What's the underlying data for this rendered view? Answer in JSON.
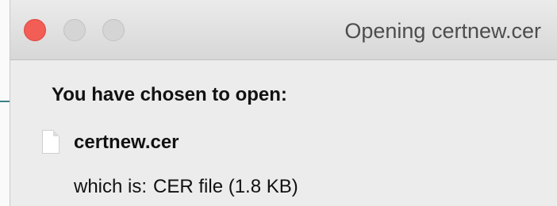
{
  "window": {
    "title": "Opening certnew.cer",
    "controls": [
      "close",
      "minimize",
      "zoom"
    ]
  },
  "dialog": {
    "heading": "You have chosen to open:",
    "file": {
      "icon": "document-icon",
      "name": "certnew.cer",
      "which_is_label": "which is:",
      "type_text": "CER file (1.8 KB)"
    }
  },
  "colors": {
    "close_button": "#f25d56",
    "inactive_button": "#d5d5d5",
    "window_bg": "#ececec",
    "teal_accent": "#3d7f86"
  }
}
